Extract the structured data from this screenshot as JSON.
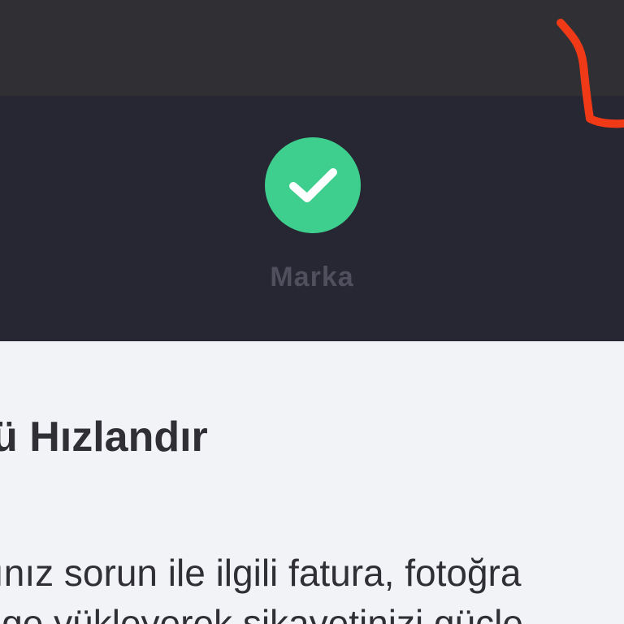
{
  "step": {
    "label": "Marka",
    "status_icon": "check-icon",
    "status_color": "#3ecf8e"
  },
  "main": {
    "heading": "ü Hızlandır",
    "body_line1": "ınız sorun ile ilgili fatura, fotoğra",
    "body_line2": "lge yükleyerek şikayetinizi güçle"
  },
  "colors": {
    "top_bar": "#303034",
    "step_panel": "#272733",
    "content_bg": "#f2f3f7",
    "annotation": "#f03a17"
  }
}
